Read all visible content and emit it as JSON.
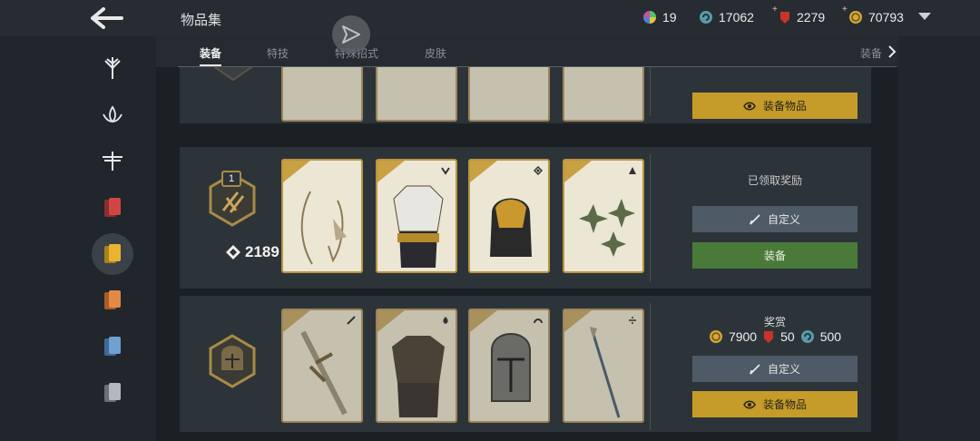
{
  "header": {
    "title": "物品集",
    "currencies": [
      {
        "icon": "color-wheel-icon",
        "value": "19"
      },
      {
        "icon": "spiral-coin-icon",
        "value": "17062"
      },
      {
        "icon": "ruby-icon",
        "value": "2279"
      },
      {
        "icon": "gold-coin-icon",
        "value": "70793"
      }
    ]
  },
  "tabs": [
    "装备",
    "特技",
    "特殊招式",
    "皮肤",
    "装备"
  ],
  "rows": [
    {
      "button1": "装备物品"
    },
    {
      "score": "2189",
      "status": "已领取奖励",
      "badge_level": "1",
      "button1": "自定义",
      "button2": "装备"
    },
    {
      "reward_title": "奖赏",
      "rewards": [
        {
          "icon": "gold-coin-icon",
          "value": "7900"
        },
        {
          "icon": "ruby-icon",
          "value": "50"
        },
        {
          "icon": "spiral-coin-icon",
          "value": "500"
        }
      ],
      "button1": "自定义",
      "button2": "装备物品"
    }
  ],
  "colors": {
    "gold": "#c59c2a",
    "green": "#4a7a3a",
    "grey": "#4e5a66",
    "background": "#20262b"
  }
}
